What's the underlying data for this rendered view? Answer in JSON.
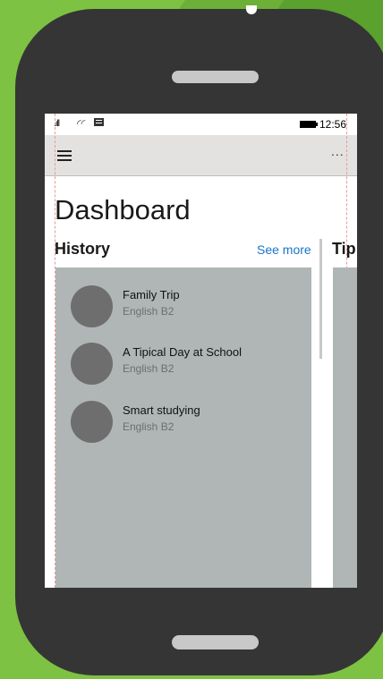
{
  "status_bar": {
    "signal_icon": "signal-bars-icon",
    "wifi_icon": "wifi-icon",
    "message_icon": "message-icon",
    "battery_icon": "battery-icon",
    "time": "12:56"
  },
  "app_bar": {
    "menu_icon": "hamburger-menu-icon",
    "more_label": "..."
  },
  "page": {
    "title": "Dashboard"
  },
  "history": {
    "title": "History",
    "see_more": "See more",
    "items": [
      {
        "title": "Family Trip",
        "subtitle": "English B2"
      },
      {
        "title": "A Tipical Day at School",
        "subtitle": "English B2"
      },
      {
        "title": "Smart studying",
        "subtitle": "English B2"
      }
    ]
  },
  "tips": {
    "title": "Tip"
  },
  "colors": {
    "background": "#7dc242",
    "phone_body": "#353535",
    "accent_link": "#1976c8",
    "card": "#b0b6b5",
    "avatar": "#6e6e6e"
  }
}
